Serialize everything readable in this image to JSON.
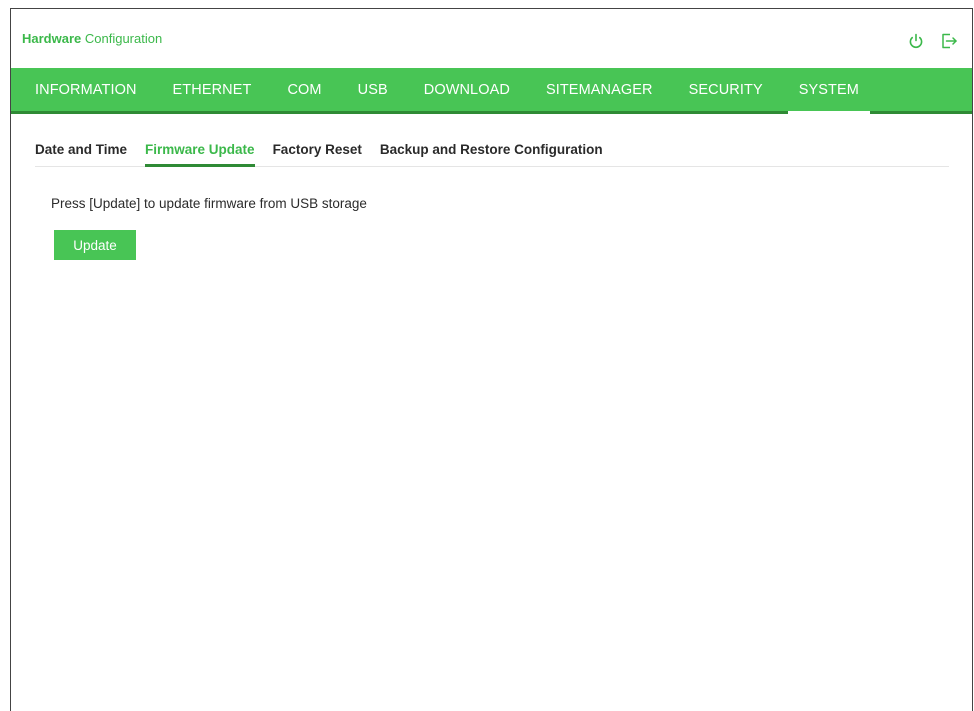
{
  "header": {
    "title_bold": "Hardware",
    "title_rest": " Configuration",
    "icons": [
      "power-icon",
      "logout-icon"
    ]
  },
  "nav": {
    "items": [
      {
        "label": "INFORMATION",
        "active": false
      },
      {
        "label": "ETHERNET",
        "active": false
      },
      {
        "label": "COM",
        "active": false
      },
      {
        "label": "USB",
        "active": false
      },
      {
        "label": "DOWNLOAD",
        "active": false
      },
      {
        "label": "SITEMANAGER",
        "active": false
      },
      {
        "label": "SECURITY",
        "active": false
      },
      {
        "label": "SYSTEM",
        "active": true
      }
    ]
  },
  "subtabs": {
    "items": [
      {
        "label": "Date and Time",
        "active": false
      },
      {
        "label": "Firmware Update",
        "active": true
      },
      {
        "label": "Factory Reset",
        "active": false
      },
      {
        "label": "Backup and Restore Configuration",
        "active": false
      }
    ]
  },
  "content": {
    "instruction": "Press [Update] to update firmware from USB storage",
    "update_label": "Update"
  },
  "colors": {
    "accent": "#48c555",
    "accent_dark": "#2f8a35",
    "title_green": "#3bb84a"
  }
}
